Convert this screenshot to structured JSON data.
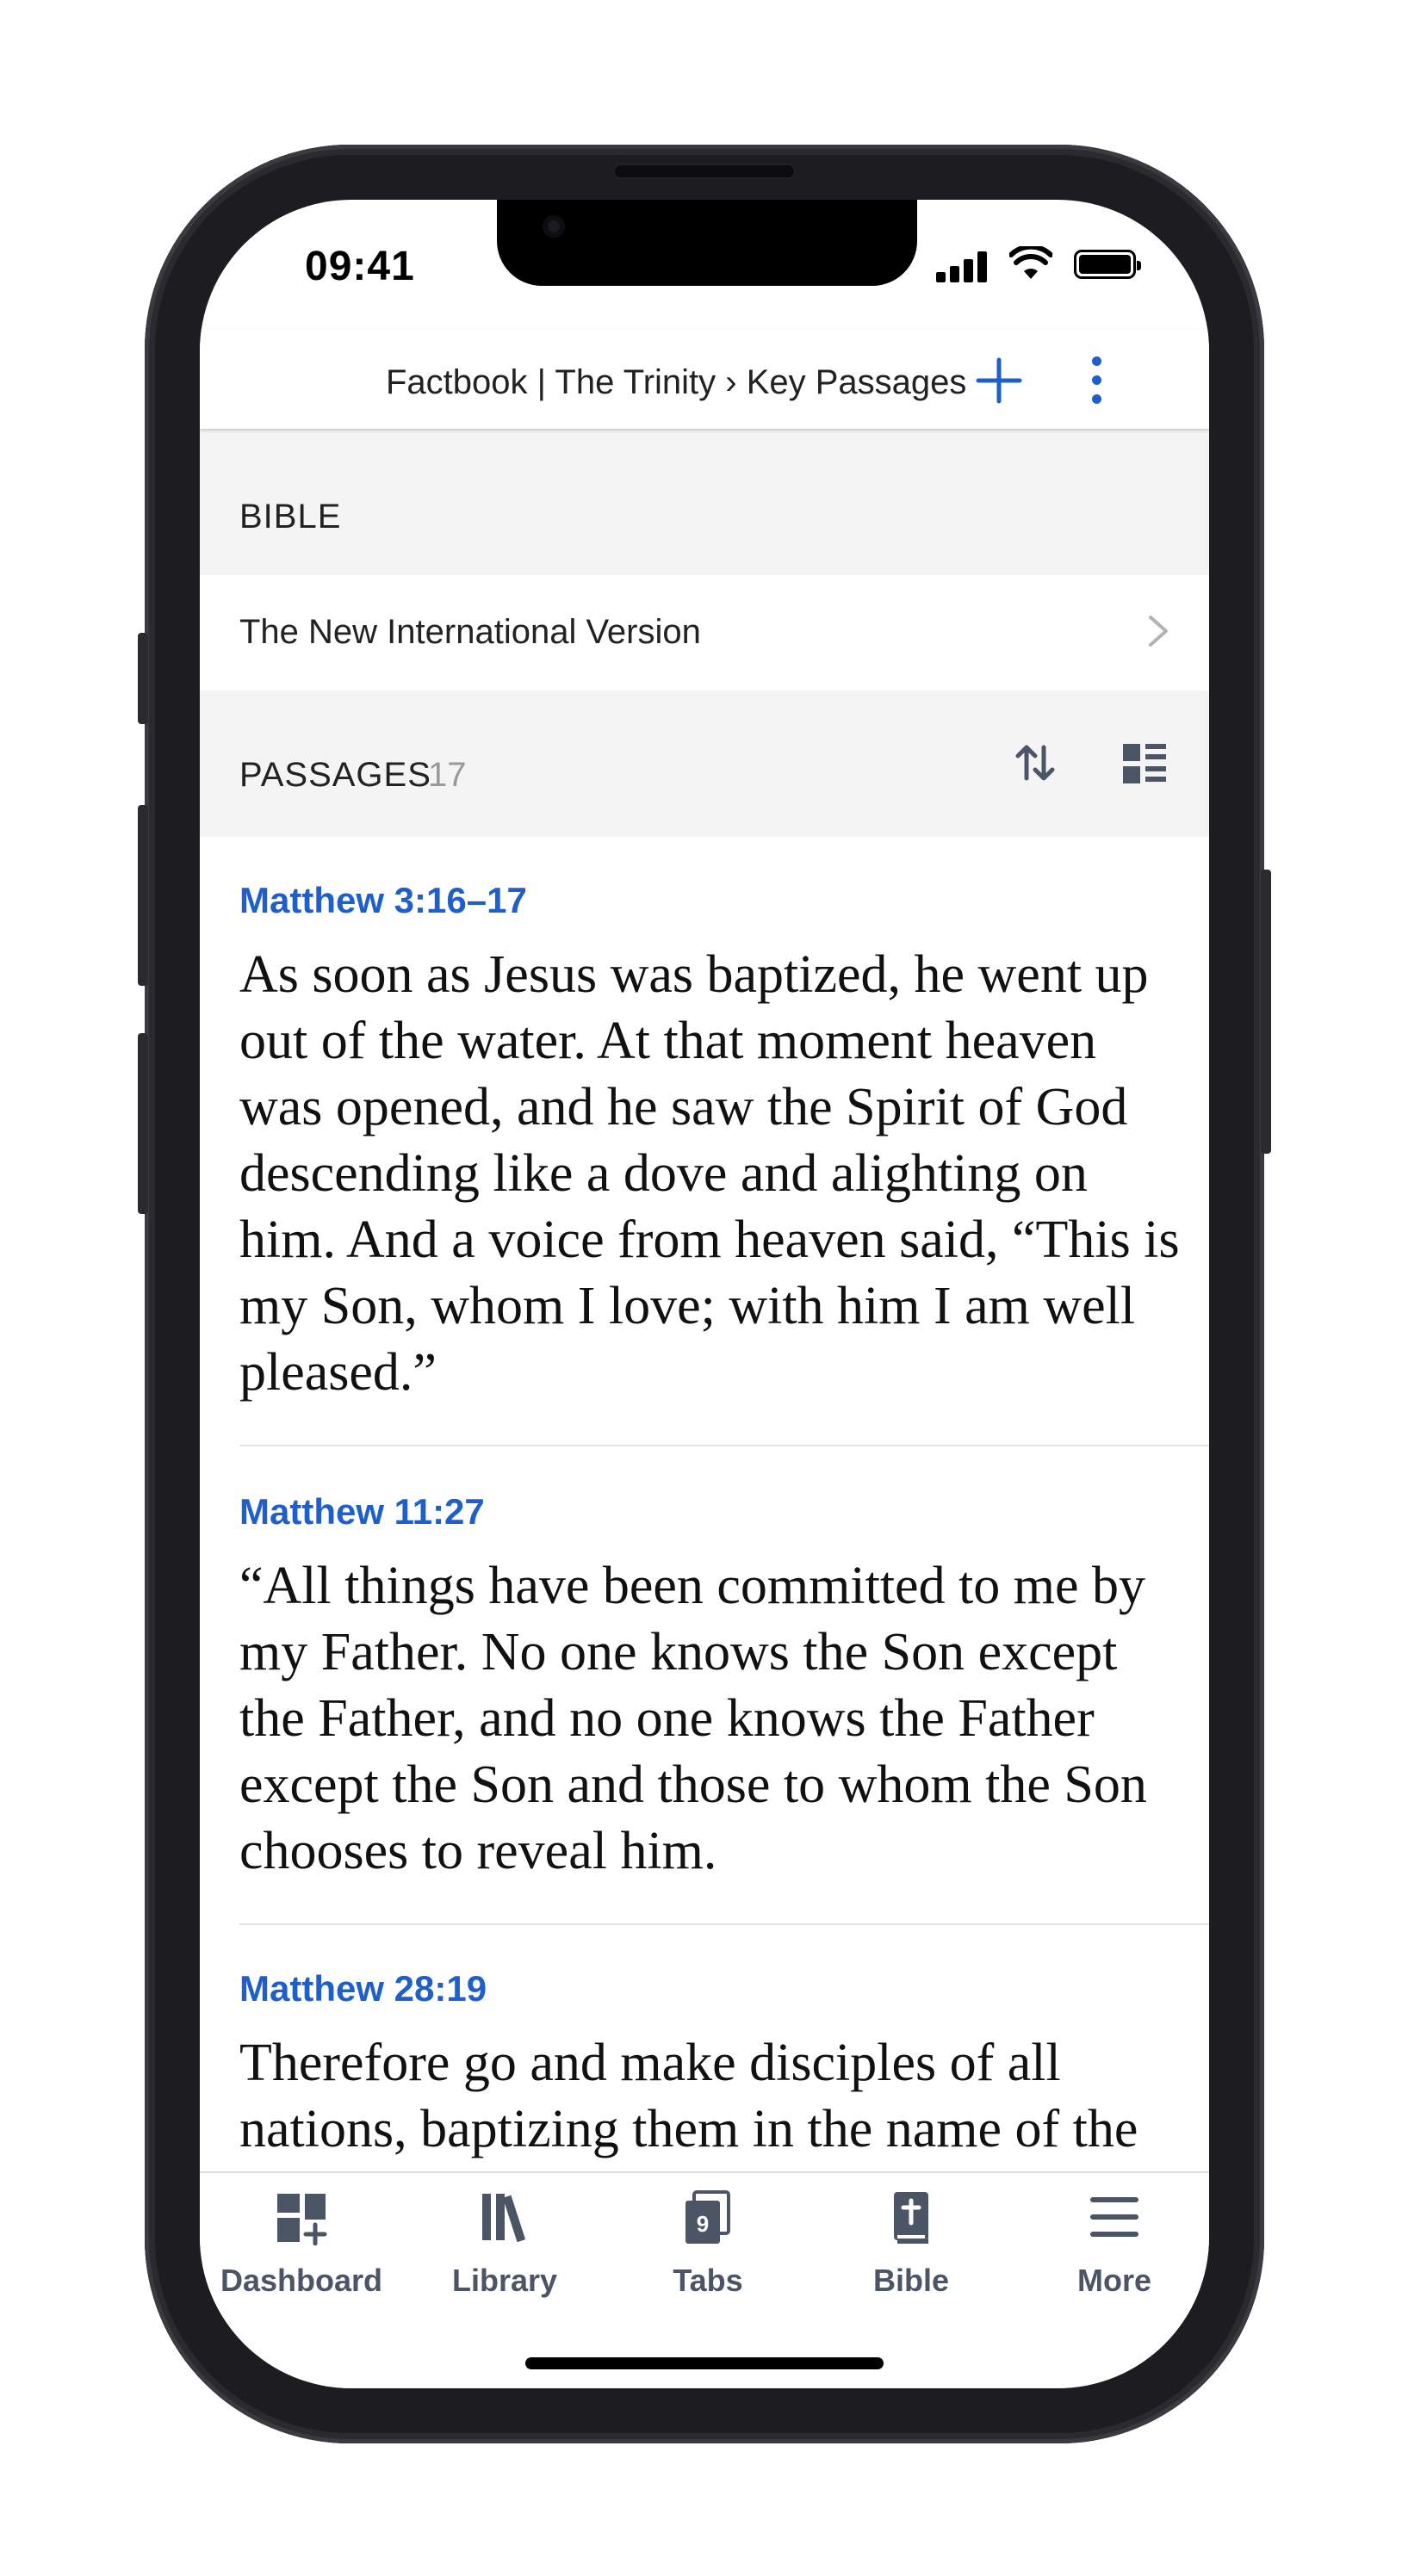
{
  "status_bar": {
    "time": "09:41"
  },
  "header": {
    "title": "Factbook | The Trinity › Key Passages",
    "add_icon": "plus-icon",
    "more_icon": "more-vertical-icon"
  },
  "bible_section": {
    "label": "BIBLE",
    "version": "The New International Version"
  },
  "passages_section": {
    "label": "PASSAGES",
    "count": "17",
    "sort_icon": "sort-icon",
    "view_icon": "list-view-icon"
  },
  "passages": [
    {
      "reference": "Matthew 3:16–17",
      "text": "As soon as Jesus was baptized, he went up out of the water. At that moment heaven was opened, and he saw the Spirit of God descending like a dove and alighting on him. And a voice from heaven said, “This is my Son, whom I love; with him I am well pleased.”"
    },
    {
      "reference": "Matthew 11:27",
      "text": "“All things have been committed to me by my Father. No one knows the Son except the Father, and no one knows the Father except the Son and those to whom the Son chooses to reveal him."
    },
    {
      "reference": "Matthew 28:19",
      "text": "Therefore go and make disciples of all nations, baptizing them in the name of the"
    }
  ],
  "tabbar": {
    "items": [
      {
        "label": "Dashboard",
        "icon": "dashboard-icon"
      },
      {
        "label": "Library",
        "icon": "library-icon"
      },
      {
        "label": "Tabs",
        "icon": "tabs-icon",
        "badge": "9"
      },
      {
        "label": "Bible",
        "icon": "bible-icon"
      },
      {
        "label": "More",
        "icon": "menu-icon"
      }
    ]
  },
  "colors": {
    "accent": "#1f5fcc",
    "tab_icon": "#4b5566",
    "section_bg": "#f4f4f4"
  }
}
